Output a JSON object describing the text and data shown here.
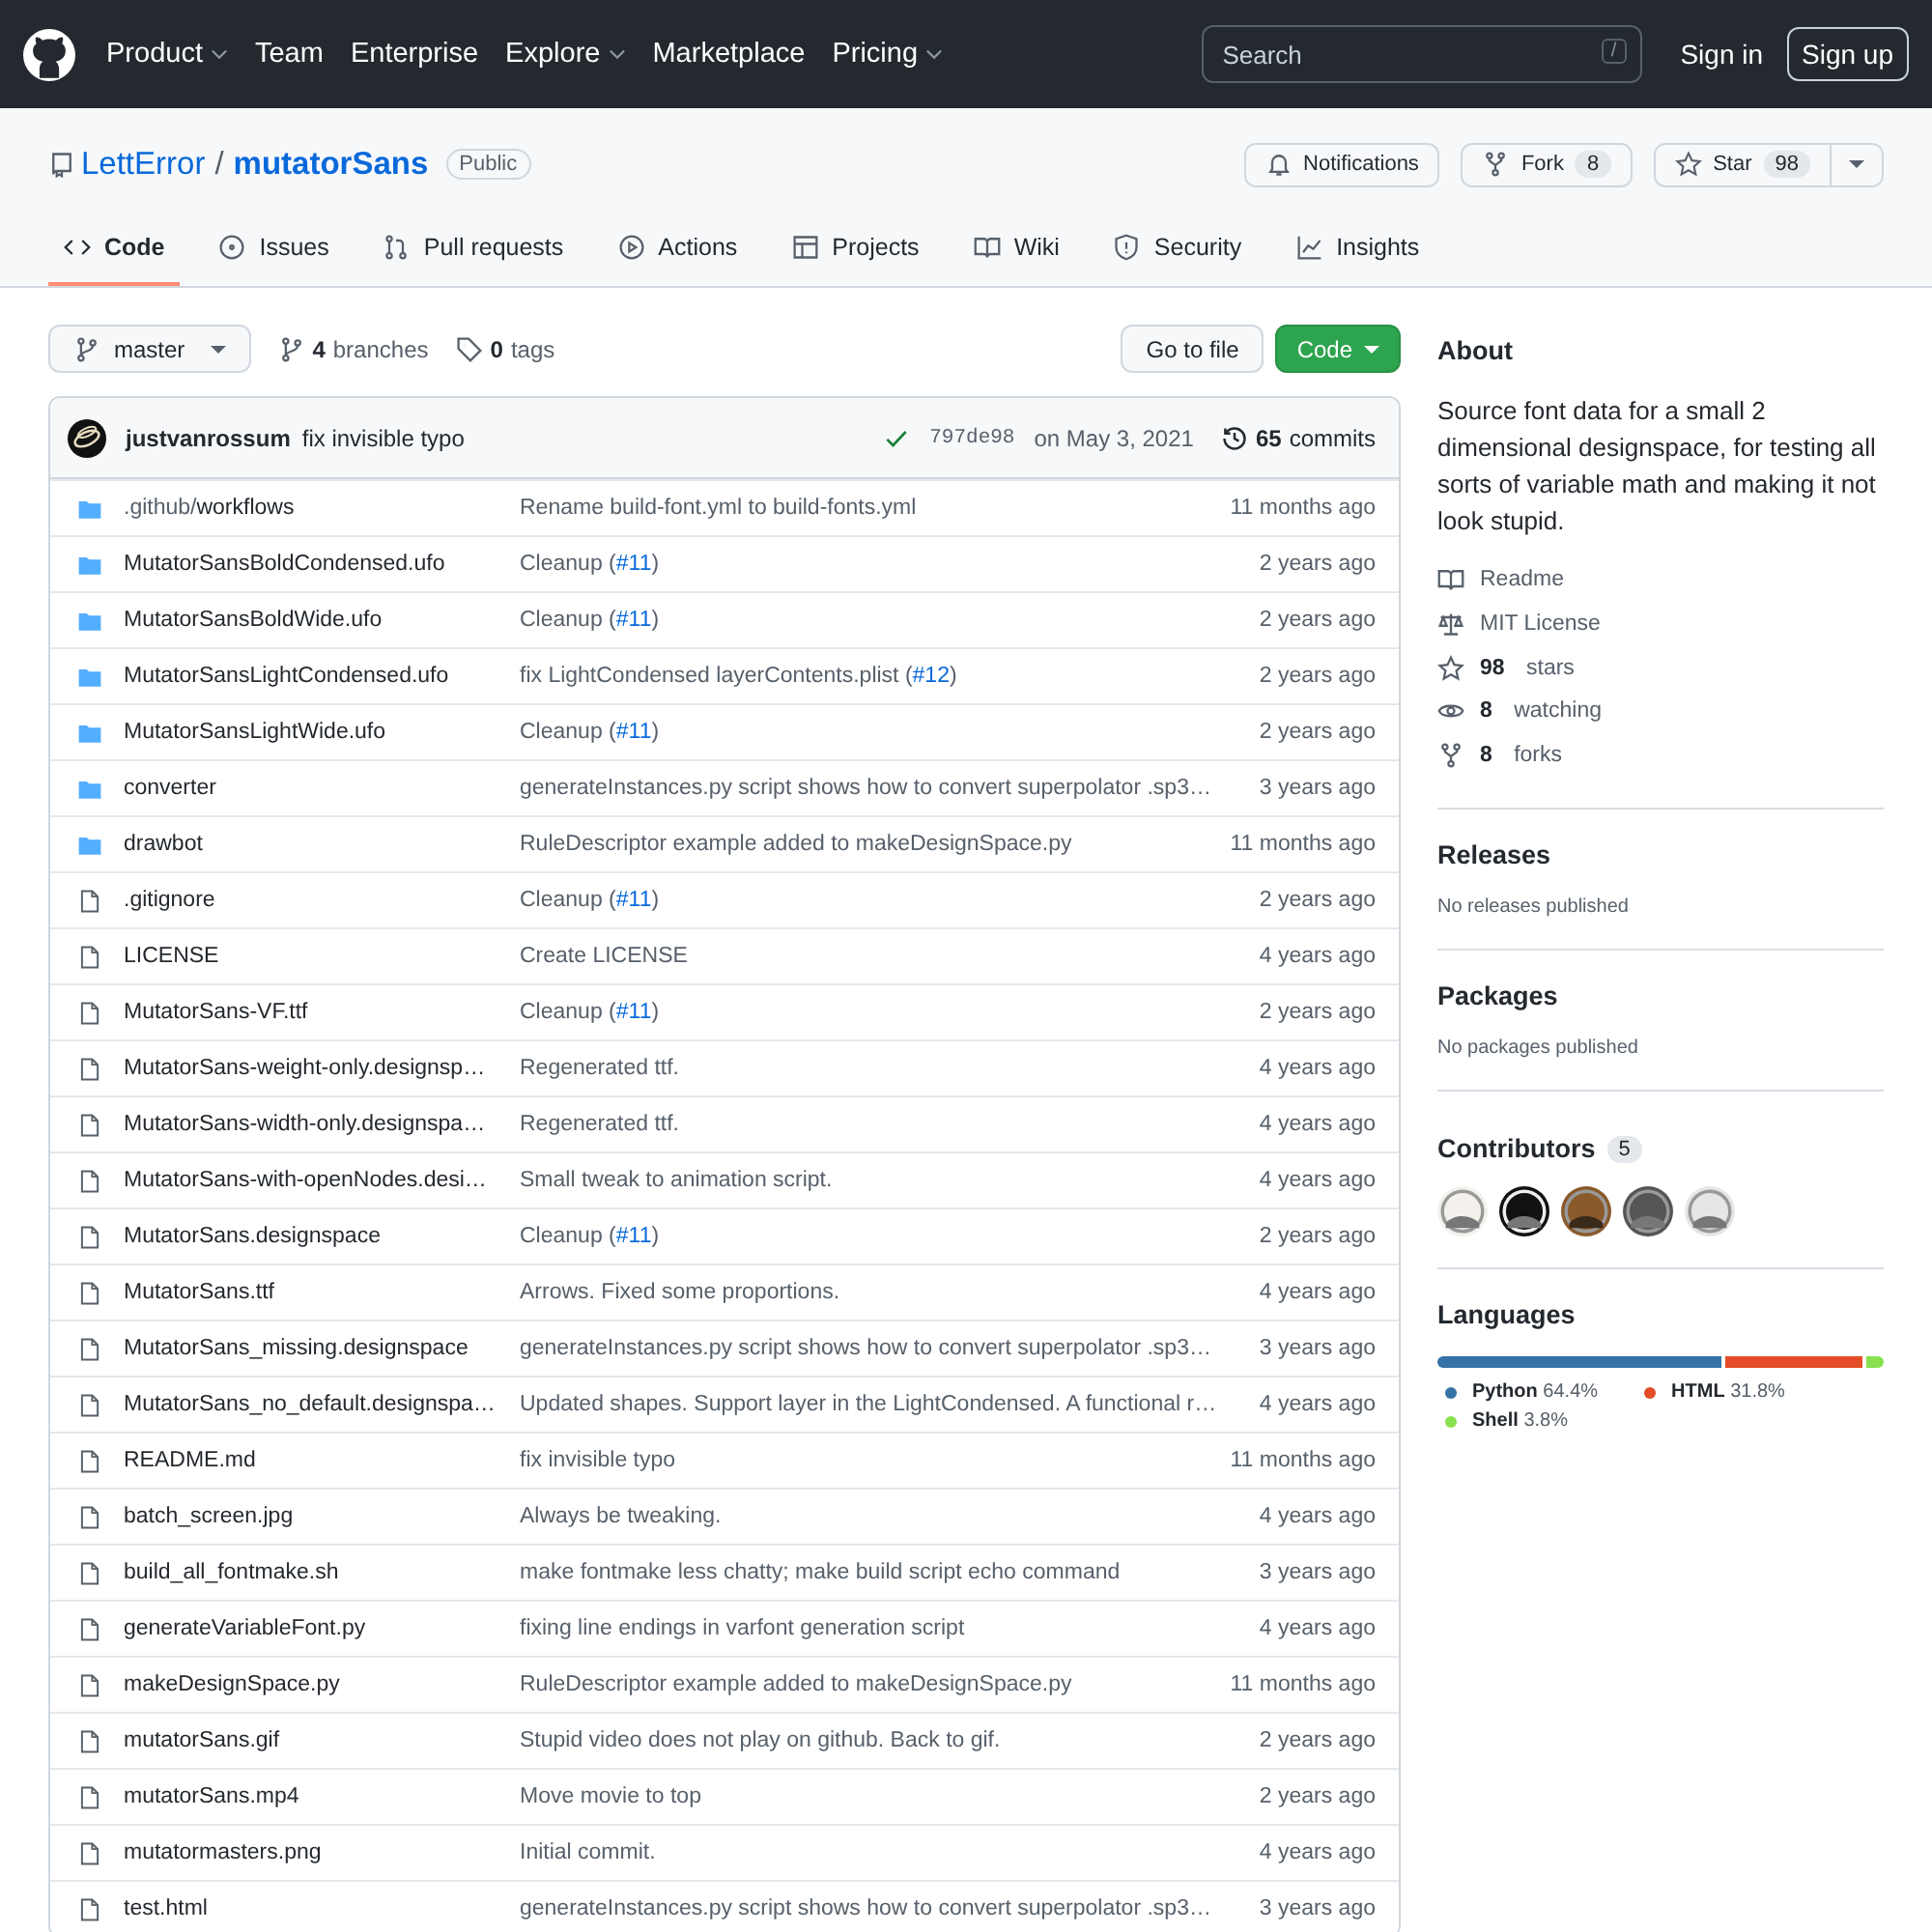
{
  "header": {
    "nav": [
      {
        "label": "Product",
        "dropdown": true
      },
      {
        "label": "Team",
        "dropdown": false
      },
      {
        "label": "Enterprise",
        "dropdown": false
      },
      {
        "label": "Explore",
        "dropdown": true
      },
      {
        "label": "Marketplace",
        "dropdown": false
      },
      {
        "label": "Pricing",
        "dropdown": true
      }
    ],
    "search": {
      "placeholder": "Search",
      "shortcut": "/"
    },
    "sign_in": "Sign in",
    "sign_up": "Sign up"
  },
  "repo": {
    "owner": "LettError",
    "separator": "/",
    "name": "mutatorSans",
    "visibility": "Public",
    "notifications": "Notifications",
    "fork": "Fork",
    "fork_count": "8",
    "star": "Star",
    "star_count": "98"
  },
  "tabs": [
    {
      "label": "Code",
      "selected": true
    },
    {
      "label": "Issues",
      "selected": false
    },
    {
      "label": "Pull requests",
      "selected": false
    },
    {
      "label": "Actions",
      "selected": false
    },
    {
      "label": "Projects",
      "selected": false
    },
    {
      "label": "Wiki",
      "selected": false
    },
    {
      "label": "Security",
      "selected": false
    },
    {
      "label": "Insights",
      "selected": false
    }
  ],
  "toolbar": {
    "branch": "master",
    "branches_count": "4",
    "branches": "branches",
    "tags_count": "0",
    "tags": "tags",
    "go_to_file": "Go to file",
    "code": "Code"
  },
  "latest_commit": {
    "author": "justvanrossum",
    "message": "fix invisible typo",
    "sha": "797de98",
    "date": "on May 3, 2021",
    "commits_count": "65",
    "commits": "commits"
  },
  "files": [
    {
      "kind": "dir",
      "name": ".github/",
      "name_end": "workflows",
      "message": "Rename build-font.yml to build-fonts.yml",
      "time": "11 months ago"
    },
    {
      "kind": "dir",
      "name": "MutatorSansBoldCondensed.ufo",
      "message": "Cleanup (",
      "link": "#11",
      "message_end": ")",
      "time": "2 years ago"
    },
    {
      "kind": "dir",
      "name": "MutatorSansBoldWide.ufo",
      "message": "Cleanup (",
      "link": "#11",
      "message_end": ")",
      "time": "2 years ago"
    },
    {
      "kind": "dir",
      "name": "MutatorSansLightCondensed.ufo",
      "message": "fix LightCondensed layerContents.plist (",
      "link": "#12",
      "message_end": ")",
      "time": "2 years ago"
    },
    {
      "kind": "dir",
      "name": "MutatorSansLightWide.ufo",
      "message": "Cleanup (",
      "link": "#11",
      "message_end": ")",
      "time": "2 years ago"
    },
    {
      "kind": "dir",
      "name": "converter",
      "message": "generateInstances.py script shows how to convert superpolator .sp3…",
      "time": "3 years ago"
    },
    {
      "kind": "dir",
      "name": "drawbot",
      "message": "RuleDescriptor example added to makeDesignSpace.py",
      "time": "11 months ago"
    },
    {
      "kind": "file",
      "name": ".gitignore",
      "message": "Cleanup (",
      "link": "#11",
      "message_end": ")",
      "time": "2 years ago"
    },
    {
      "kind": "file",
      "name": "LICENSE",
      "message": "Create LICENSE",
      "time": "4 years ago"
    },
    {
      "kind": "file",
      "name": "MutatorSans-VF.ttf",
      "message": "Cleanup (",
      "link": "#11",
      "message_end": ")",
      "time": "2 years ago"
    },
    {
      "kind": "file",
      "name": "MutatorSans-weight-only.designsp…",
      "message": "Regenerated ttf.",
      "time": "4 years ago"
    },
    {
      "kind": "file",
      "name": "MutatorSans-width-only.designspa…",
      "message": "Regenerated ttf.",
      "time": "4 years ago"
    },
    {
      "kind": "file",
      "name": "MutatorSans-with-openNodes.desi…",
      "message": "Small tweak to animation script.",
      "time": "4 years ago"
    },
    {
      "kind": "file",
      "name": "MutatorSans.designspace",
      "message": "Cleanup (",
      "link": "#11",
      "message_end": ")",
      "time": "2 years ago"
    },
    {
      "kind": "file",
      "name": "MutatorSans.ttf",
      "message": "Arrows. Fixed some proportions.",
      "time": "4 years ago"
    },
    {
      "kind": "file",
      "name": "MutatorSans_missing.designspace",
      "message": "generateInstances.py script shows how to convert superpolator .sp3…",
      "time": "3 years ago"
    },
    {
      "kind": "file",
      "name": "MutatorSans_no_default.designspa…",
      "message": "Updated shapes. Support layer in the LightCondensed. A functional r…",
      "time": "4 years ago"
    },
    {
      "kind": "file",
      "name": "README.md",
      "message": "fix invisible typo",
      "time": "11 months ago"
    },
    {
      "kind": "file",
      "name": "batch_screen.jpg",
      "message": "Always be tweaking.",
      "time": "4 years ago"
    },
    {
      "kind": "file",
      "name": "build_all_fontmake.sh",
      "message": "make fontmake less chatty; make build script echo command",
      "time": "3 years ago"
    },
    {
      "kind": "file",
      "name": "generateVariableFont.py",
      "message": "fixing line endings in varfont generation script",
      "time": "4 years ago"
    },
    {
      "kind": "file",
      "name": "makeDesignSpace.py",
      "message": "RuleDescriptor example added to makeDesignSpace.py",
      "time": "11 months ago"
    },
    {
      "kind": "file",
      "name": "mutatorSans.gif",
      "message": "Stupid video does not play on github. Back to gif.",
      "time": "2 years ago"
    },
    {
      "kind": "file",
      "name": "mutatorSans.mp4",
      "message": "Move movie to top",
      "time": "2 years ago"
    },
    {
      "kind": "file",
      "name": "mutatormasters.png",
      "message": "Initial commit.",
      "time": "4 years ago"
    },
    {
      "kind": "file",
      "name": "test.html",
      "message": "generateInstances.py script shows how to convert superpolator .sp3…",
      "time": "3 years ago"
    }
  ],
  "about": {
    "title": "About",
    "description": "Source font data for a small 2 dimensional designspace, for testing all sorts of variable math and making it not look stupid.",
    "links": [
      {
        "label": "Readme"
      },
      {
        "label": "MIT License"
      },
      {
        "count": "98",
        "label": "stars"
      },
      {
        "count": "8",
        "label": "watching"
      },
      {
        "count": "8",
        "label": "forks"
      }
    ]
  },
  "releases": {
    "title": "Releases",
    "note": "No releases published"
  },
  "packages": {
    "title": "Packages",
    "note": "No packages published"
  },
  "contributors": {
    "title": "Contributors",
    "count": "5"
  },
  "languages": {
    "title": "Languages",
    "items": [
      {
        "name": "Python",
        "percent": "64.4%",
        "color": "#3572a5"
      },
      {
        "name": "HTML",
        "percent": "31.8%",
        "color": "#e34c26"
      },
      {
        "name": "Shell",
        "percent": "3.8%",
        "color": "#89e051"
      }
    ]
  }
}
